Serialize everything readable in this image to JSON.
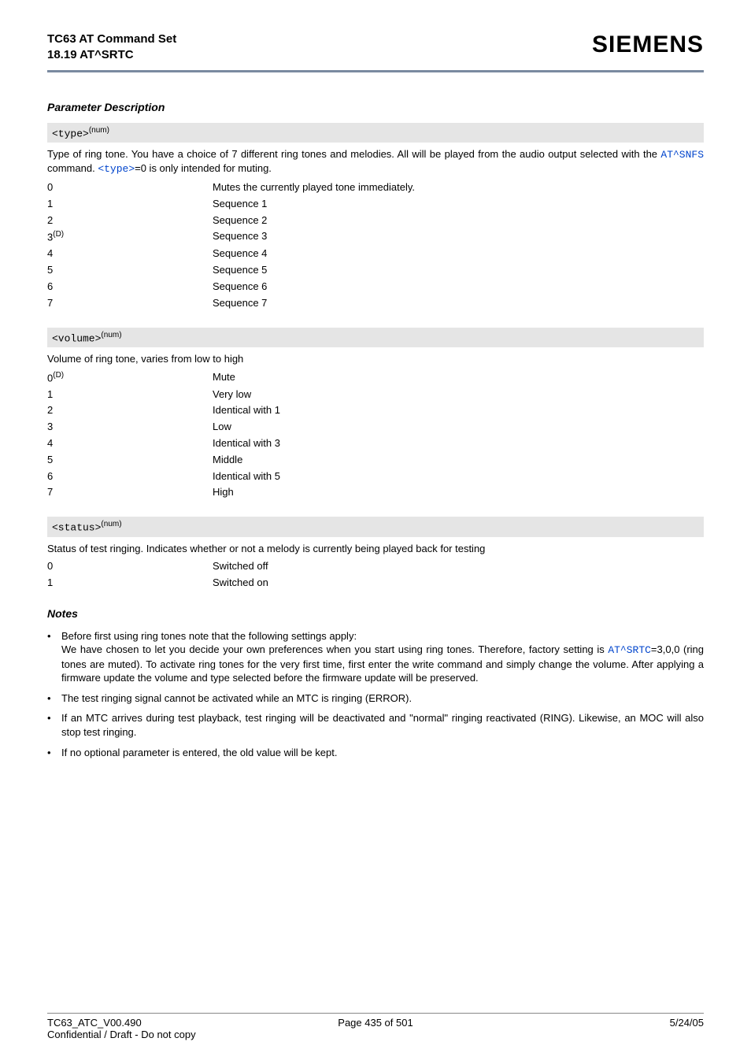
{
  "header": {
    "doc_title": "TC63 AT Command Set",
    "section": "18.19 AT^SRTC",
    "logo": "SIEMENS"
  },
  "section_title": "Parameter Description",
  "params": [
    {
      "name_code": "<type>",
      "name_sup": "(num)",
      "desc_pre": "Type of ring tone. You have a choice of 7 different ring tones and melodies. All will be played from the audio output selected with the ",
      "desc_code1": "AT^SNFS",
      "desc_mid": " command. ",
      "desc_code2": "<type>",
      "desc_post": "=0 is only intended for muting.",
      "rows": [
        {
          "k": "0",
          "sup": "",
          "v": "Mutes the currently played tone immediately."
        },
        {
          "k": "1",
          "sup": "",
          "v": "Sequence 1"
        },
        {
          "k": "2",
          "sup": "",
          "v": "Sequence 2"
        },
        {
          "k": "3",
          "sup": "(D)",
          "v": "Sequence 3"
        },
        {
          "k": "4",
          "sup": "",
          "v": "Sequence 4"
        },
        {
          "k": "5",
          "sup": "",
          "v": "Sequence 5"
        },
        {
          "k": "6",
          "sup": "",
          "v": "Sequence 6"
        },
        {
          "k": "7",
          "sup": "",
          "v": "Sequence 7"
        }
      ]
    },
    {
      "name_code": "<volume>",
      "name_sup": "(num)",
      "desc_plain": "Volume of ring tone, varies from low to high",
      "rows": [
        {
          "k": "0",
          "sup": "(D)",
          "v": "Mute"
        },
        {
          "k": "1",
          "sup": "",
          "v": "Very low"
        },
        {
          "k": "2",
          "sup": "",
          "v": "Identical with 1"
        },
        {
          "k": "3",
          "sup": "",
          "v": "Low"
        },
        {
          "k": "4",
          "sup": "",
          "v": "Identical with 3"
        },
        {
          "k": "5",
          "sup": "",
          "v": "Middle"
        },
        {
          "k": "6",
          "sup": "",
          "v": "Identical with 5"
        },
        {
          "k": "7",
          "sup": "",
          "v": "High"
        }
      ]
    },
    {
      "name_code": "<status>",
      "name_sup": "(num)",
      "desc_plain": "Status of test ringing. Indicates whether or not a melody is currently being played back for testing",
      "rows": [
        {
          "k": "0",
          "sup": "",
          "v": "Switched off"
        },
        {
          "k": "1",
          "sup": "",
          "v": "Switched on"
        }
      ]
    }
  ],
  "notes_title": "Notes",
  "notes": [
    {
      "line1": "Before first using ring tones note that the following settings apply:",
      "line2_pre": "We have chosen to let you decide your own preferences when you start using ring tones. Therefore, factory setting is ",
      "line2_code": "AT^SRTC",
      "line2_post": "=3,0,0 (ring tones are muted). To activate ring tones for the very first time, first enter the write command and simply change the volume. After applying a firmware update the volume and type selected before the firmware update will be preserved."
    },
    {
      "text": "The test ringing signal cannot be activated while an MTC is ringing (ERROR)."
    },
    {
      "text": "If an MTC arrives during test playback, test ringing will be deactivated and \"normal\" ringing reactivated (RING). Likewise, an MOC will also stop test ringing."
    },
    {
      "text": "If no optional parameter is entered, the old value will be kept."
    }
  ],
  "footer": {
    "left1": "TC63_ATC_V00.490",
    "left2": "Confidential / Draft - Do not copy",
    "center": "Page 435 of 501",
    "right": "5/24/05"
  }
}
